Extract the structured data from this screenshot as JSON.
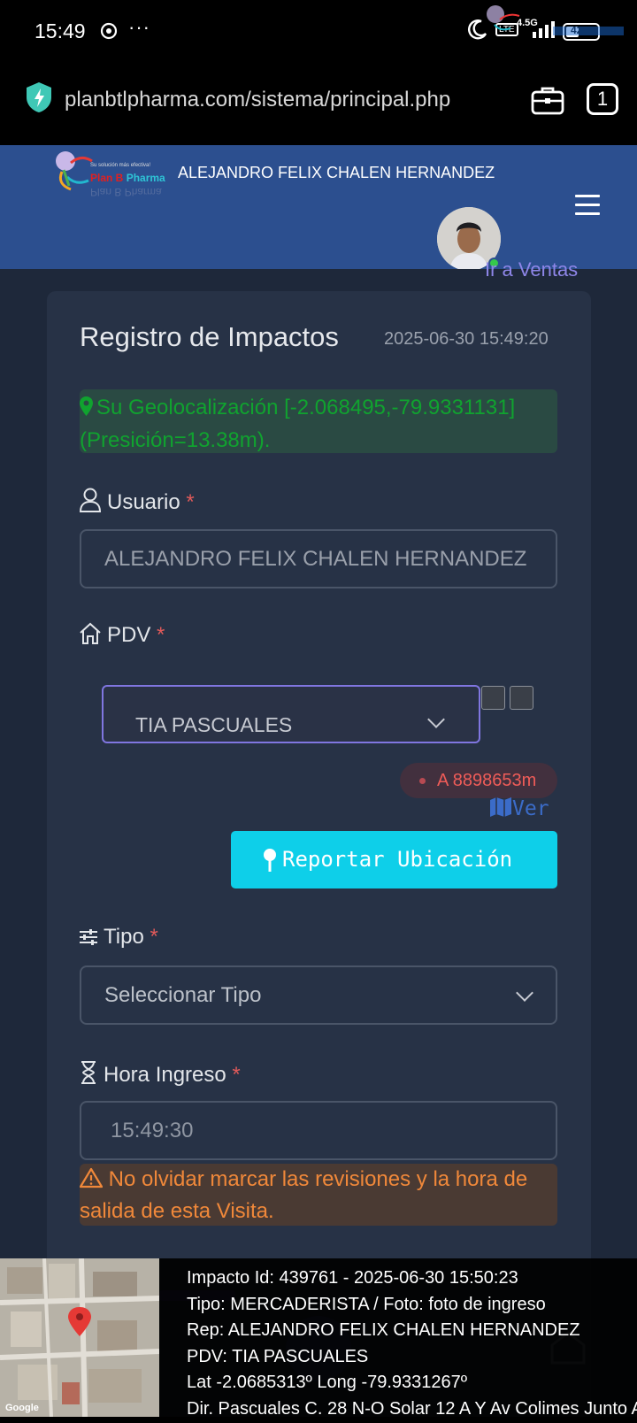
{
  "status_bar": {
    "time": "15:49",
    "more_indicator": "···",
    "sim_label": "LTE",
    "net_speed": "4.5G",
    "battery_level": "42",
    "battery_fraction": 0.42
  },
  "browser": {
    "url": "planbtlpharma.com/sistema/principal.php",
    "tab_count": "1"
  },
  "header": {
    "brand_tagline": "Su solución más efectiva!",
    "brand_name_a": "Plan B ",
    "brand_name_b": "Pharma",
    "brand_reflection": "Plan B Pharma",
    "user_name": "ALEJANDRO FELIX CHALEN HERNANDEZ",
    "goto_sales": "Ir a Ventas"
  },
  "card": {
    "title": "Registro de Impactos",
    "datetime": "2025-06-30 15:49:20",
    "geo_text": "Su Geolocalización [-2.068495,-79.9331131] (Presición=13.38m).",
    "usuario_label": "Usuario",
    "required_mark": "*",
    "usuario_value": "ALEJANDRO FELIX CHALEN HERNANDEZ",
    "pdv_label": "PDV",
    "pdv_value": "TIA PASCUALES",
    "distance": "A 8898653m",
    "ver_label": "Ver",
    "report_button": "Reportar Ubicación",
    "tipo_label": "Tipo",
    "tipo_placeholder": "Seleccionar Tipo",
    "hora_label": "Hora Ingreso",
    "hora_value": "15:49:30",
    "warning": "No olvidar marcar las revisiones y la hora de salida de esta Visita."
  },
  "toast": {
    "line1": "Impacto Id: 439761 - 2025-06-30 15:50:23",
    "line2": "Tipo: MERCADERISTA / Foto: foto de ingreso",
    "line3": "Rep: ALEJANDRO FELIX CHALEN HERNANDEZ",
    "line4": "PDV: TIA PASCUALES",
    "line5": "Lat -2.0685313º Long -79.9331267º",
    "line6": "Dir. Pascuales C. 28 N-O Solar 12 A Y Av Colimes Junto A",
    "map_credit": "Google"
  },
  "colors": {
    "header_bg": "#2c4f8f",
    "page_bg": "#1e283a",
    "card_bg": "#273246",
    "accent_cyan": "#0ecfe9",
    "accent_purple": "#8076e0",
    "required_red": "#e05a5a",
    "geo_green": "#10a32f",
    "warning_orange": "#f0883a"
  },
  "icons": {
    "location_status": "location-pin-icon",
    "moon": "moon-icon",
    "secure": "shield-bolt-icon",
    "briefcase": "briefcase-icon",
    "user": "user-icon",
    "home": "home-icon",
    "sliders": "sliders-icon",
    "hourglass": "hourglass-icon",
    "map": "map-icon",
    "pin": "pin-icon",
    "warning": "warning-triangle-icon"
  }
}
